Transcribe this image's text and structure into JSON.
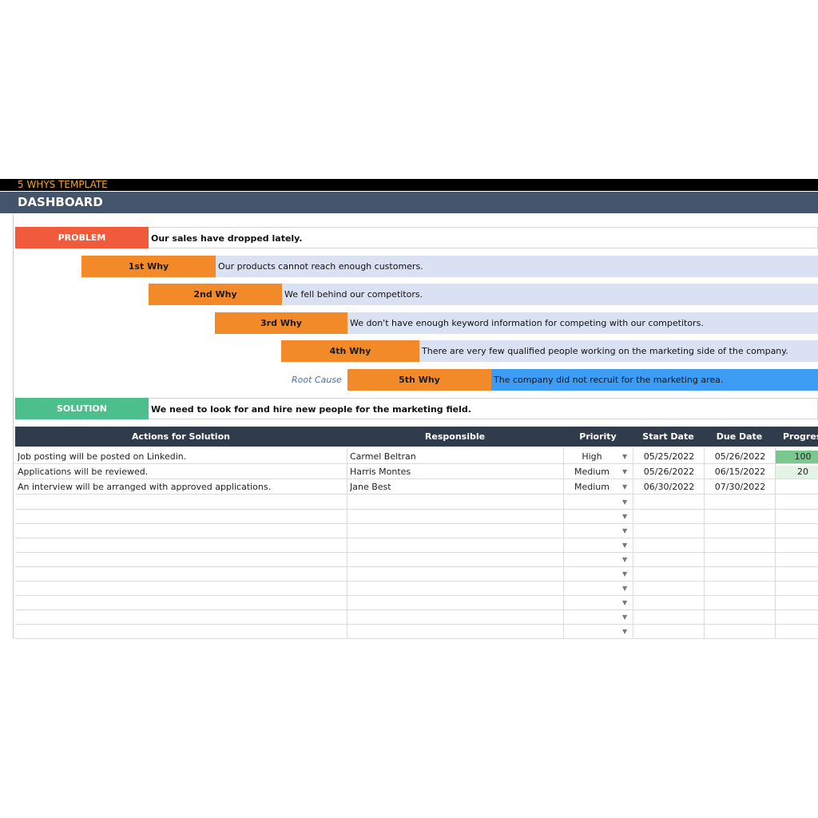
{
  "header": {
    "template_title": "5 WHYS TEMPLATE",
    "dashboard_title": "DASHBOARD"
  },
  "problem": {
    "label": "PROBLEM",
    "text": "Our sales have dropped lately."
  },
  "whys": [
    {
      "label": "1st Why",
      "text": "Our products cannot reach enough customers."
    },
    {
      "label": "2nd Why",
      "text": "We fell behind our competitors."
    },
    {
      "label": "3rd Why",
      "text": "We don't have enough keyword information for competing with our competitors."
    },
    {
      "label": "4th Why",
      "text": "There are very few qualified people working on the marketing side of the company."
    },
    {
      "label": "5th Why",
      "text": "The company did not recruit for the marketing area."
    }
  ],
  "root_cause_label": "Root Cause",
  "solution": {
    "label": "SOLUTION",
    "text": "We need to look for and hire new people for the marketing field."
  },
  "table": {
    "headers": {
      "actions": "Actions for Solution",
      "responsible": "Responsible",
      "priority": "Priority",
      "start": "Start Date",
      "due": "Due Date",
      "progress": "Progress"
    },
    "rows": [
      {
        "action": "Job posting will be posted on Linkedin.",
        "responsible": "Carmel Beltran",
        "priority": "High",
        "start": "05/25/2022",
        "due": "05/26/2022",
        "progress": "100"
      },
      {
        "action": "Applications will be reviewed.",
        "responsible": "Harris Montes",
        "priority": "Medium",
        "start": "05/26/2022",
        "due": "06/15/2022",
        "progress": "20"
      },
      {
        "action": "An interview will be arranged with approved applications.",
        "responsible": "Jane Best",
        "priority": "Medium",
        "start": "06/30/2022",
        "due": "07/30/2022",
        "progress": ""
      }
    ],
    "empty_rows": 10
  },
  "colors": {
    "problem": "#f15a3a",
    "why": "#f28a2a",
    "why_text_bg": "#dae1f2",
    "root_text_bg": "#3d9df4",
    "solution": "#4cbf8c",
    "header_bar": "#44546a",
    "table_header": "#303c4c",
    "progress_high": "#7bc88f",
    "progress_low": "#e3f4e5"
  },
  "icons": {
    "dropdown": "dropdown-arrow-icon"
  }
}
